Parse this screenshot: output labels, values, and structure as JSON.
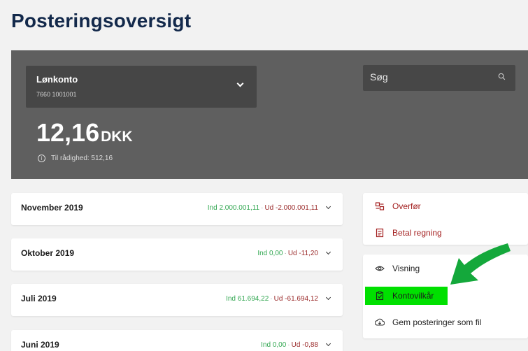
{
  "page": {
    "title": "Posteringsoversigt"
  },
  "account": {
    "name": "Lønkonto",
    "number": "7660 1001001",
    "balance": "12,16",
    "currency": "DKK",
    "available_text": "Til rådighed: 512,16"
  },
  "search": {
    "placeholder": "Søg",
    "value": ""
  },
  "months": [
    {
      "label": "November 2019",
      "in": "Ind 2.000.001,11",
      "separator": "·",
      "out": "Ud -2.000.001,11"
    },
    {
      "label": "Oktober 2019",
      "in": "Ind 0,00",
      "separator": "·",
      "out": "Ud -11,20"
    },
    {
      "label": "Juli 2019",
      "in": "Ind 61.694,22",
      "separator": "·",
      "out": "Ud -61.694,12"
    },
    {
      "label": "Juni 2019",
      "in": "Ind 0,00",
      "separator": "·",
      "out": "Ud -0,88"
    }
  ],
  "actions_primary": [
    {
      "label": "Overfør",
      "icon": "transfer-icon"
    },
    {
      "label": "Betal regning",
      "icon": "bill-icon"
    }
  ],
  "actions_secondary": [
    {
      "label": "Visning",
      "icon": "eye-icon"
    },
    {
      "label": "Kontovilkår",
      "icon": "clipboard-check-icon"
    },
    {
      "label": "Gem posteringer som fil",
      "icon": "download-icon"
    }
  ],
  "colors": {
    "title": "#13294b",
    "panel": "#5f5f5f",
    "in_amount": "#34a853",
    "out_amount": "#9b2c2c",
    "action_red": "#a31f1f",
    "highlight": "#00e000",
    "arrow": "#14a83b"
  },
  "annotation": {
    "highlighted_item": "Kontovilkår",
    "arrow": "green-arrow-icon"
  }
}
